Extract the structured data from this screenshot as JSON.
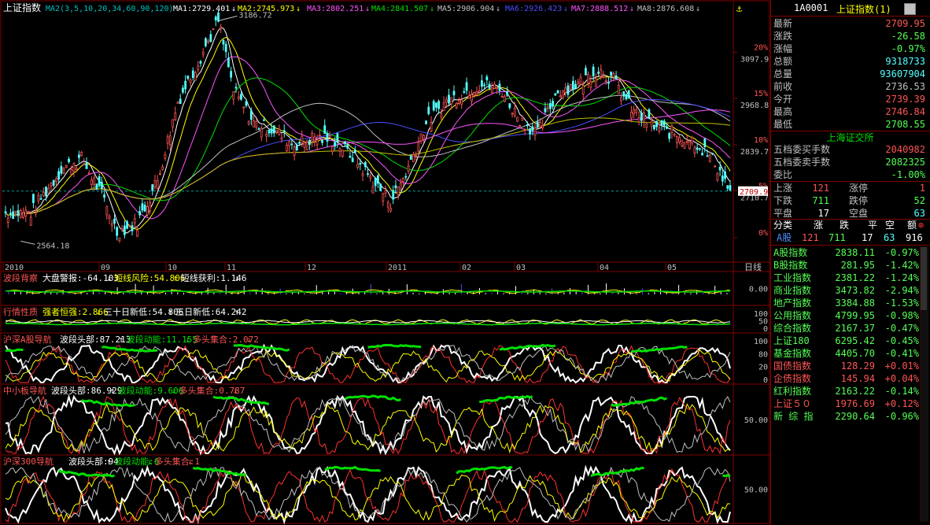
{
  "colors": {
    "up": "#ff5454",
    "down": "#54ffff",
    "neutral": "#c0c0c0",
    "vol_blue": "#4d4dff",
    "green": "#00e000",
    "yellow": "#ffff00",
    "pink": "#ff54ff",
    "grid": "#800000",
    "dashed": "#00a0a0"
  },
  "main_header": {
    "title": "上证指数",
    "ma_setting": "MA2(3,5,10,20,34,60,90,120)",
    "ma": [
      {
        "label": "MA1:2729.401",
        "arrow": "↓",
        "color": "#ffffff"
      },
      {
        "label": "MA2:2745.973",
        "arrow": "↓",
        "color": "#ffff00"
      },
      {
        "label": "MA3:2802.251",
        "arrow": "↓",
        "color": "#ff54ff"
      },
      {
        "label": "MA4:2841.507",
        "arrow": "↓",
        "color": "#00e000"
      },
      {
        "label": "MA5:2906.904",
        "arrow": "↓",
        "color": "#c0c0c0"
      },
      {
        "label": "MA6:2926.423",
        "arrow": "↓",
        "color": "#4d4dff"
      },
      {
        "label": "MA7:2888.512",
        "arrow": "↓",
        "color": "#ff54ff"
      },
      {
        "label": "MA8:2876.608",
        "arrow": "↓",
        "color": "#c0c0c0"
      }
    ],
    "anchor_icon": "anchor-icon"
  },
  "main_chart": {
    "high_label": "3186.72",
    "low_label": "2564.18",
    "y_ticks": [
      {
        "price": "3097.9",
        "pct": "20%"
      },
      {
        "price": "2968.8",
        "pct": "15%"
      },
      {
        "price": "2839.7",
        "pct": "10%"
      },
      {
        "price": "2710.7",
        "pct": "5%"
      },
      {
        "price": "",
        "pct": "0%"
      }
    ],
    "current_price_label": "2709.9",
    "x_labels": [
      "2010",
      "09",
      "10",
      "11",
      "12",
      "2011",
      "02",
      "03",
      "04",
      "05"
    ],
    "period_label": "日线"
  },
  "panels": [
    {
      "title": "波段背察",
      "items": [
        {
          "text": "大盘警报:-64.103",
          "arrow": "↓",
          "color": "#ffffff"
        },
        {
          "text": "短线风险:54.806",
          "arrow": "↑",
          "color": "#ffff00"
        },
        {
          "text": "短线获利:1.146",
          "arrow": "↓",
          "color": "#ffffff"
        }
      ],
      "ticks": [
        "0.00"
      ]
    },
    {
      "title": "行情性质",
      "items": [
        {
          "text": "强者恒强:2.866",
          "arrow": "↓",
          "color": "#ffff00"
        },
        {
          "text": "三十日新低:54.806",
          "arrow": "↑",
          "color": "#ffffff"
        },
        {
          "text": "三日新低:64.242",
          "arrow": "↑",
          "color": "#ffffff"
        }
      ],
      "ticks": [
        "100",
        "50",
        "0"
      ]
    },
    {
      "title": "沪深A股导航",
      "items": [
        {
          "text": "波段头部:87.213",
          "arrow": "↑",
          "color": "#ffffff"
        },
        {
          "text": "波段动能:11.155",
          "arrow": "↓",
          "color": "#00e000"
        },
        {
          "text": "多头集合:2.072",
          "arrow": "↓",
          "color": "#ff5454"
        }
      ],
      "ticks": [
        "100",
        "80",
        "20",
        "0"
      ]
    },
    {
      "title": "中小板导航",
      "items": [
        {
          "text": "波段头部:86.929",
          "arrow": "↑",
          "color": "#ffffff"
        },
        {
          "text": "波段动能:9.606",
          "arrow": "↓",
          "color": "#00e000"
        },
        {
          "text": "多头集合:0.787",
          "arrow": "↓",
          "color": "#ff5454"
        }
      ],
      "ticks": [
        "50.00"
      ]
    },
    {
      "title": "沪深300导航",
      "items": [
        {
          "text": "波段头部:94",
          "arrow": "↑",
          "color": "#ffffff"
        },
        {
          "text": "波段动能:6",
          "arrow": "↓",
          "color": "#00e000"
        },
        {
          "text": "多头集合:1",
          "arrow": "↓",
          "color": "#ff5454"
        }
      ],
      "ticks": [
        "50.00"
      ]
    }
  ],
  "quote": {
    "code": "1A0001",
    "name": "上证指数(1)",
    "rows": [
      {
        "label": "最新",
        "value": "2709.95",
        "color": "#ff5454"
      },
      {
        "label": "涨跌",
        "value": "-26.58",
        "color": "#54ff54"
      },
      {
        "label": "涨幅",
        "value": "-0.97%",
        "color": "#54ff54"
      },
      {
        "label": "总额",
        "value": "9318733",
        "color": "#54ffff"
      },
      {
        "label": "总量",
        "value": "93607904",
        "color": "#54ffff"
      },
      {
        "label": "前收",
        "value": "2736.53",
        "color": "#c0c0c0"
      },
      {
        "label": "今开",
        "value": "2739.39",
        "color": "#ff5454"
      },
      {
        "label": "最高",
        "value": "2746.84",
        "color": "#ff5454"
      },
      {
        "label": "最低",
        "value": "2708.55",
        "color": "#54ff54"
      }
    ],
    "exchange": "上海证交所",
    "book": [
      {
        "label": "五档委买手数",
        "value": "2040982",
        "color": "#ff5454"
      },
      {
        "label": "五档委卖手数",
        "value": "2082325",
        "color": "#54ff54"
      },
      {
        "label": "委比",
        "value": "-1.00%",
        "color": "#54ff54"
      }
    ],
    "breadth": [
      {
        "l1": "上涨",
        "v1": "121",
        "c1": "#ff5454",
        "l2": "涨停",
        "v2": "1",
        "c2": "#ff5454"
      },
      {
        "l1": "下跌",
        "v1": "711",
        "c1": "#54ff54",
        "l2": "跌停",
        "v2": "52",
        "c2": "#54ff54"
      },
      {
        "l1": "平盘",
        "v1": "17",
        "c1": "#ffffff",
        "l2": "空盘",
        "v2": "63",
        "c2": "#54ffff"
      }
    ],
    "cat_header": [
      "分类",
      "涨",
      "跌",
      "平",
      "空",
      "额"
    ],
    "cat_row": {
      "name": "A股",
      "up": "121",
      "down": "711",
      "flat": "17",
      "empty": "63",
      "amount": "916"
    },
    "indices": [
      {
        "name": "A股指数",
        "value": "2838.11",
        "chg": "-0.97%",
        "color": "#54ff54"
      },
      {
        "name": "B股指数",
        "value": "281.95",
        "chg": "-1.42%",
        "color": "#54ff54"
      },
      {
        "name": "工业指数",
        "value": "2381.22",
        "chg": "-1.24%",
        "color": "#54ff54"
      },
      {
        "name": "商业指数",
        "value": "3473.82",
        "chg": "-2.94%",
        "color": "#54ff54"
      },
      {
        "name": "地产指数",
        "value": "3384.88",
        "chg": "-1.53%",
        "color": "#54ff54"
      },
      {
        "name": "公用指数",
        "value": "4799.95",
        "chg": "-0.98%",
        "color": "#54ff54"
      },
      {
        "name": "综合指数",
        "value": "2167.37",
        "chg": "-0.47%",
        "color": "#54ff54"
      },
      {
        "name": "上证180",
        "value": "6295.42",
        "chg": "-0.45%",
        "color": "#54ff54"
      },
      {
        "name": "基金指数",
        "value": "4405.70",
        "chg": "-0.41%",
        "color": "#54ff54"
      },
      {
        "name": "国债指数",
        "value": "128.29",
        "chg": "+0.01%",
        "color": "#ff5454"
      },
      {
        "name": "企债指数",
        "value": "145.94",
        "chg": "+0.04%",
        "color": "#ff5454"
      },
      {
        "name": "红利指数",
        "value": "2163.22",
        "chg": "-0.14%",
        "color": "#54ff54"
      },
      {
        "name": "上证５０",
        "value": "1976.69",
        "chg": "+0.12%",
        "color": "#ff5454"
      },
      {
        "name": "新 综 指",
        "value": "2290.64",
        "chg": "-0.96%",
        "color": "#54ff54"
      }
    ]
  }
}
